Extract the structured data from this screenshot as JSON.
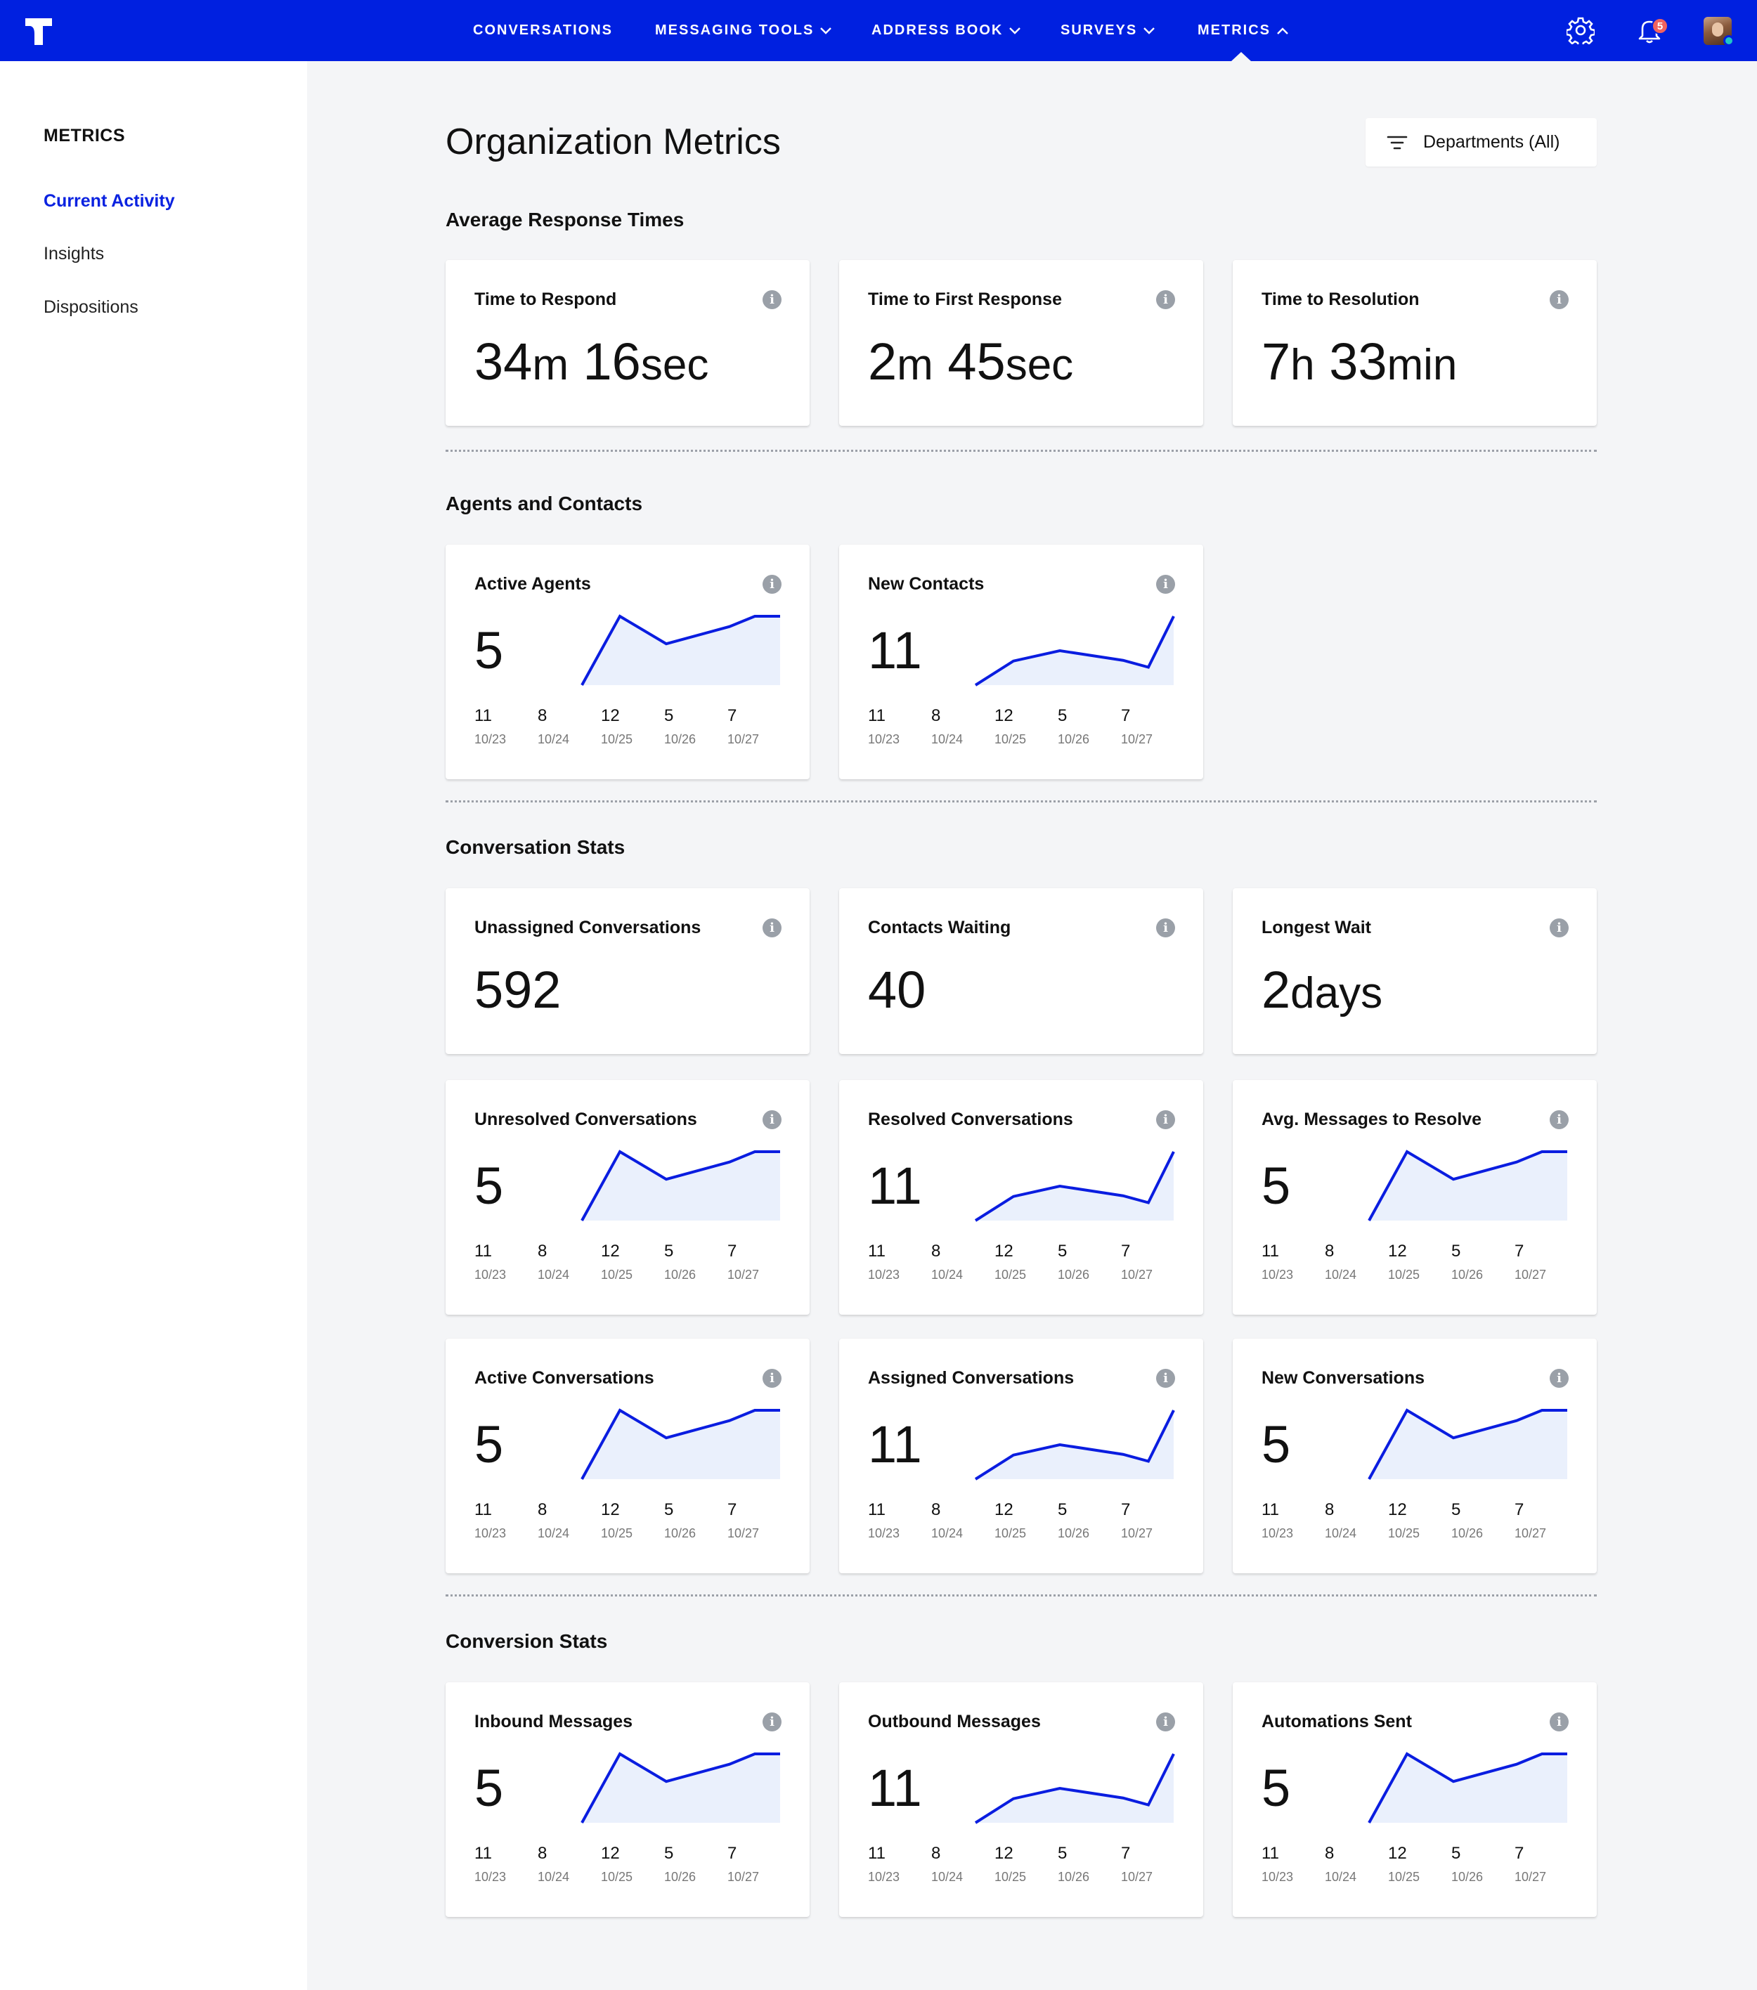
{
  "nav": {
    "items": [
      "CONVERSATIONS",
      "MESSAGING TOOLS",
      "ADDRESS BOOK",
      "SURVEYS",
      "METRICS"
    ],
    "notification_count": "5"
  },
  "sidebar": {
    "title": "METRICS",
    "items": [
      "Current Activity",
      "Insights",
      "Dispositions"
    ],
    "active": "Current Activity"
  },
  "page": {
    "title": "Organization Metrics",
    "filter_label": "Departments (All)"
  },
  "colors": {
    "brand": "#0020e0",
    "line": "#0a1de0",
    "fill": "#eaf0fc",
    "active_link": "#0a22e0",
    "badge": "#f2635f"
  },
  "sections": {
    "response": {
      "title": "Average Response Times",
      "cards": [
        {
          "title": "Time to Respond",
          "parts": [
            [
              "34",
              "m"
            ],
            [
              "16",
              "sec"
            ]
          ]
        },
        {
          "title": "Time to First Response",
          "parts": [
            [
              "2",
              "m"
            ],
            [
              "45",
              "sec"
            ]
          ]
        },
        {
          "title": "Time to Resolution",
          "parts": [
            [
              "7",
              "h"
            ],
            [
              "33",
              "min"
            ]
          ]
        }
      ]
    },
    "agents": {
      "title": "Agents and Contacts",
      "cards": [
        {
          "title": "Active Agents",
          "value": "5",
          "series": "a"
        },
        {
          "title": "New Contacts",
          "value": "11",
          "series": "b"
        }
      ]
    },
    "conversation": {
      "title": "Conversation Stats",
      "stat_cards": [
        {
          "title": "Unassigned Conversations",
          "value": "592"
        },
        {
          "title": "Contacts Waiting",
          "value": "40"
        },
        {
          "title": "Longest Wait",
          "parts": [
            [
              "2",
              "days"
            ]
          ]
        }
      ],
      "cards": [
        {
          "title": "Unresolved Conversations",
          "value": "5",
          "series": "a"
        },
        {
          "title": "Resolved Conversations",
          "value": "11",
          "series": "b"
        },
        {
          "title": "Avg. Messages to Resolve",
          "value": "5",
          "series": "a"
        },
        {
          "title": "Active Conversations",
          "value": "5",
          "series": "a"
        },
        {
          "title": "Assigned Conversations",
          "value": "11",
          "series": "b"
        },
        {
          "title": "New Conversations",
          "value": "5",
          "series": "a"
        }
      ]
    },
    "conversion": {
      "title": "Conversion Stats",
      "cards": [
        {
          "title": "Inbound Messages",
          "value": "5",
          "series": "a"
        },
        {
          "title": "Outbound Messages",
          "value": "11",
          "series": "b"
        },
        {
          "title": "Automations Sent",
          "value": "5",
          "series": "a"
        }
      ]
    }
  },
  "chart_data": {
    "type": "line",
    "sparklines": {
      "a": {
        "shape": [
          0,
          1,
          0.6,
          0.85,
          1,
          1
        ]
      },
      "b": {
        "shape": [
          0,
          0.35,
          0.5,
          0.36,
          0.26,
          1
        ]
      }
    },
    "points": [
      {
        "value": "11",
        "date": "10/23"
      },
      {
        "value": "8",
        "date": "10/24"
      },
      {
        "value": "12",
        "date": "10/25"
      },
      {
        "value": "5",
        "date": "10/26"
      },
      {
        "value": "7",
        "date": "10/27"
      }
    ]
  }
}
